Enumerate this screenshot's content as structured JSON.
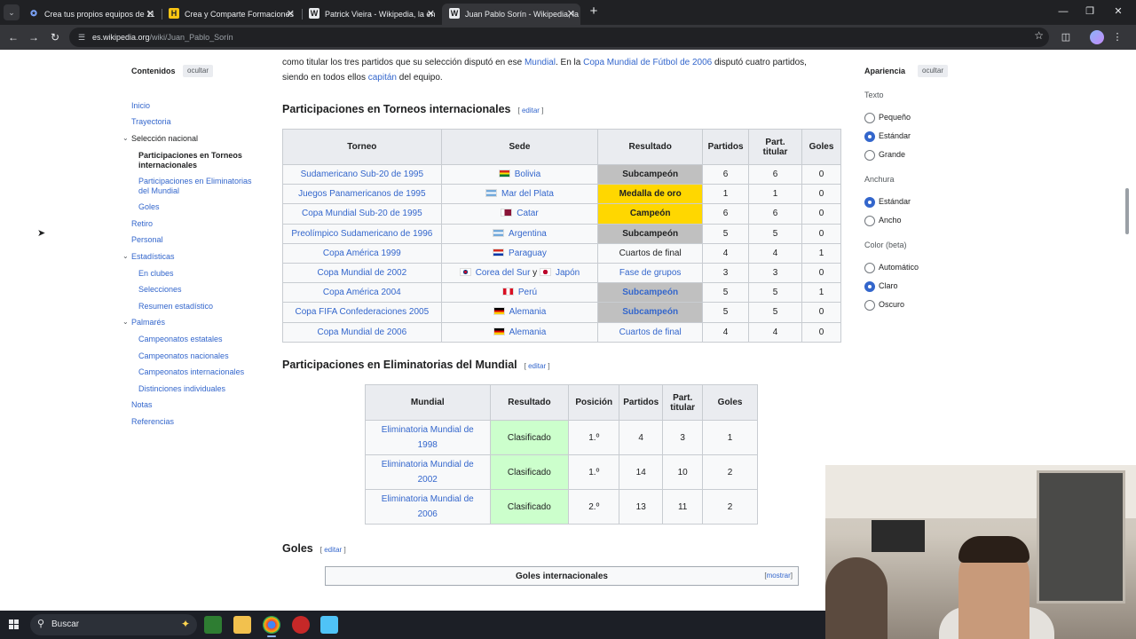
{
  "browser": {
    "tabs": [
      {
        "title": "Crea tus propios equipos de 11",
        "favicon": "team-favicon",
        "active": false
      },
      {
        "title": "Crea y Comparte Formaciones",
        "favicon": "h-favicon",
        "active": false
      },
      {
        "title": "Patrick Vieira - Wikipedia, la en",
        "favicon": "wikipedia-favicon",
        "active": false
      },
      {
        "title": "Juan Pablo Sorín - Wikipedia, la",
        "favicon": "wikipedia-favicon",
        "active": true
      }
    ],
    "url_domain": "es.wikipedia.org",
    "url_path": "/wiki/Juan_Pablo_Sorín"
  },
  "toc": {
    "title": "Contenidos",
    "hide_label": "ocultar",
    "items": [
      {
        "label": "Inicio",
        "level": 1
      },
      {
        "label": "Trayectoria",
        "level": 1
      },
      {
        "label": "Selección nacional",
        "level": 1,
        "expanded": true
      },
      {
        "label": "Participaciones en Torneos internacionales",
        "level": 2,
        "current": true
      },
      {
        "label": "Participaciones en Eliminatorias del Mundial",
        "level": 2
      },
      {
        "label": "Goles",
        "level": 2
      },
      {
        "label": "Retiro",
        "level": 1
      },
      {
        "label": "Personal",
        "level": 1
      },
      {
        "label": "Estadísticas",
        "level": 1,
        "expanded": true
      },
      {
        "label": "En clubes",
        "level": 2
      },
      {
        "label": "Selecciones",
        "level": 2
      },
      {
        "label": "Resumen estadístico",
        "level": 2
      },
      {
        "label": "Palmarés",
        "level": 1,
        "expanded": true
      },
      {
        "label": "Campeonatos estatales",
        "level": 2
      },
      {
        "label": "Campeonatos nacionales",
        "level": 2
      },
      {
        "label": "Campeonatos internacionales",
        "level": 2
      },
      {
        "label": "Distinciones individuales",
        "level": 2
      },
      {
        "label": "Notas",
        "level": 1
      },
      {
        "label": "Referencias",
        "level": 1
      }
    ]
  },
  "intro": {
    "line1_a": "como titular los tres partidos que su selección disputó en ese ",
    "line1_link1": "Mundial",
    "line1_b": ". En la ",
    "line1_link2": "Copa Mundial de Fútbol de 2006",
    "line1_c": " disputó cuatro partidos,",
    "line2_a": "siendo en todos ellos ",
    "line2_link": "capitán",
    "line2_b": " del equipo."
  },
  "section1": {
    "heading": "Participaciones en Torneos internacionales",
    "edit": "editar",
    "headers": [
      "Torneo",
      "Sede",
      "Resultado",
      "Partidos",
      "Part. titular",
      "Goles"
    ],
    "rows": [
      {
        "torneo": "Sudamericano Sub-20 de 1995",
        "sede": "Bolivia",
        "flag": "bolivia",
        "resultado": "Subcampeón",
        "style": "silver",
        "partidos": "6",
        "titular": "6",
        "goles": "0"
      },
      {
        "torneo": "Juegos Panamericanos de 1995",
        "sede": "Mar del Plata",
        "flag": "argentina",
        "resultado": "Medalla de oro",
        "style": "gold",
        "partidos": "1",
        "titular": "1",
        "goles": "0"
      },
      {
        "torneo": "Copa Mundial Sub-20 de 1995",
        "sede": "Catar",
        "flag": "qatar",
        "resultado": "Campeón",
        "style": "gold",
        "partidos": "6",
        "titular": "6",
        "goles": "0"
      },
      {
        "torneo": "Preolímpico Sudamericano de 1996",
        "sede": "Argentina",
        "flag": "argentina",
        "resultado": "Subcampeón",
        "style": "silver",
        "partidos": "5",
        "titular": "5",
        "goles": "0"
      },
      {
        "torneo": "Copa América 1999",
        "sede": "Paraguay",
        "flag": "paraguay",
        "resultado": "Cuartos de final",
        "style": "plain",
        "partidos": "4",
        "titular": "4",
        "goles": "1"
      },
      {
        "torneo": "Copa Mundial de 2002",
        "sede": "Corea del Sur",
        "sede_sep": " y ",
        "sede2": "Japón",
        "flag": "korea",
        "flag2": "japan",
        "resultado": "Fase de grupos",
        "style": "link",
        "partidos": "3",
        "titular": "3",
        "goles": "0"
      },
      {
        "torneo": "Copa América 2004",
        "sede": "Perú",
        "flag": "peru",
        "resultado": "Subcampeón",
        "style": "silver-link",
        "partidos": "5",
        "titular": "5",
        "goles": "1"
      },
      {
        "torneo": "Copa FIFA Confederaciones 2005",
        "sede": "Alemania",
        "flag": "germany",
        "resultado": "Subcampeón",
        "style": "silver-link",
        "partidos": "5",
        "titular": "5",
        "goles": "0"
      },
      {
        "torneo": "Copa Mundial de 2006",
        "sede": "Alemania",
        "flag": "germany",
        "resultado": "Cuartos de final",
        "style": "link",
        "partidos": "4",
        "titular": "4",
        "goles": "0"
      }
    ]
  },
  "section2": {
    "heading": "Participaciones en Eliminatorias del Mundial",
    "edit": "editar",
    "headers": [
      "Mundial",
      "Resultado",
      "Posición",
      "Partidos",
      "Part. titular",
      "Goles"
    ],
    "rows": [
      {
        "mundial": "Eliminatoria Mundial de 1998",
        "resultado": "Clasificado",
        "posicion": "1.º",
        "partidos": "4",
        "titular": "3",
        "goles": "1"
      },
      {
        "mundial": "Eliminatoria Mundial de 2002",
        "resultado": "Clasificado",
        "posicion": "1.º",
        "partidos": "14",
        "titular": "10",
        "goles": "2"
      },
      {
        "mundial": "Eliminatoria Mundial de 2006",
        "resultado": "Clasificado",
        "posicion": "2.º",
        "partidos": "13",
        "titular": "11",
        "goles": "2"
      }
    ]
  },
  "section3": {
    "heading": "Goles",
    "edit": "editar",
    "box_title": "Goles internacionales",
    "show_label": "mostrar"
  },
  "appearance": {
    "title": "Apariencia",
    "hide_label": "ocultar",
    "groups": [
      {
        "label": "Texto",
        "options": [
          {
            "label": "Pequeño",
            "checked": false
          },
          {
            "label": "Estándar",
            "checked": true
          },
          {
            "label": "Grande",
            "checked": false
          }
        ]
      },
      {
        "label": "Anchura",
        "options": [
          {
            "label": "Estándar",
            "checked": true
          },
          {
            "label": "Ancho",
            "checked": false
          }
        ]
      },
      {
        "label": "Color (beta)",
        "options": [
          {
            "label": "Automático",
            "checked": false
          },
          {
            "label": "Claro",
            "checked": true
          },
          {
            "label": "Oscuro",
            "checked": false
          }
        ]
      }
    ]
  },
  "taskbar": {
    "search_placeholder": "Buscar"
  }
}
